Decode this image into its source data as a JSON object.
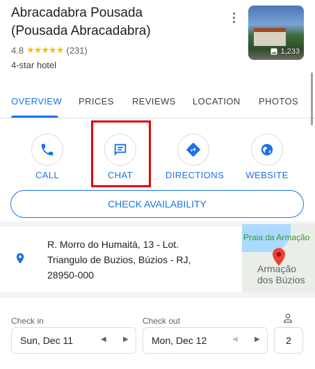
{
  "header": {
    "title_line1": "Abracadabra Pousada",
    "title_line2": "(Pousada Abracadabra)",
    "rating": "4.8",
    "stars": "★★★★★",
    "review_count": "(231)",
    "hotel_class": "4-star hotel",
    "photo_count": "1,233"
  },
  "tabs": [
    {
      "label": "OVERVIEW",
      "active": true
    },
    {
      "label": "PRICES"
    },
    {
      "label": "REVIEWS"
    },
    {
      "label": "LOCATION"
    },
    {
      "label": "PHOTOS"
    }
  ],
  "actions": {
    "call": "CALL",
    "chat": "CHAT",
    "directions": "DIRECTIONS",
    "website": "WEBSITE"
  },
  "check_availability": "CHECK AVAILABILITY",
  "address": {
    "line1": "R. Morro do Humaitá, 13 - Lot.",
    "line2": "Triangulo de Buzios, Búzios - RJ,",
    "line3": "28950-000"
  },
  "map": {
    "label_top": "Praia da Armação",
    "label_bottom_1": "Armação",
    "label_bottom_2": "dos Búzios"
  },
  "booking": {
    "check_in_label": "Check in",
    "check_in_value": "Sun, Dec 11",
    "check_out_label": "Check out",
    "check_out_value": "Mon, Dec 12",
    "guests": "2"
  },
  "colors": {
    "accent": "#1a73e8",
    "star": "#fbbc04",
    "highlight": "#e00000"
  }
}
